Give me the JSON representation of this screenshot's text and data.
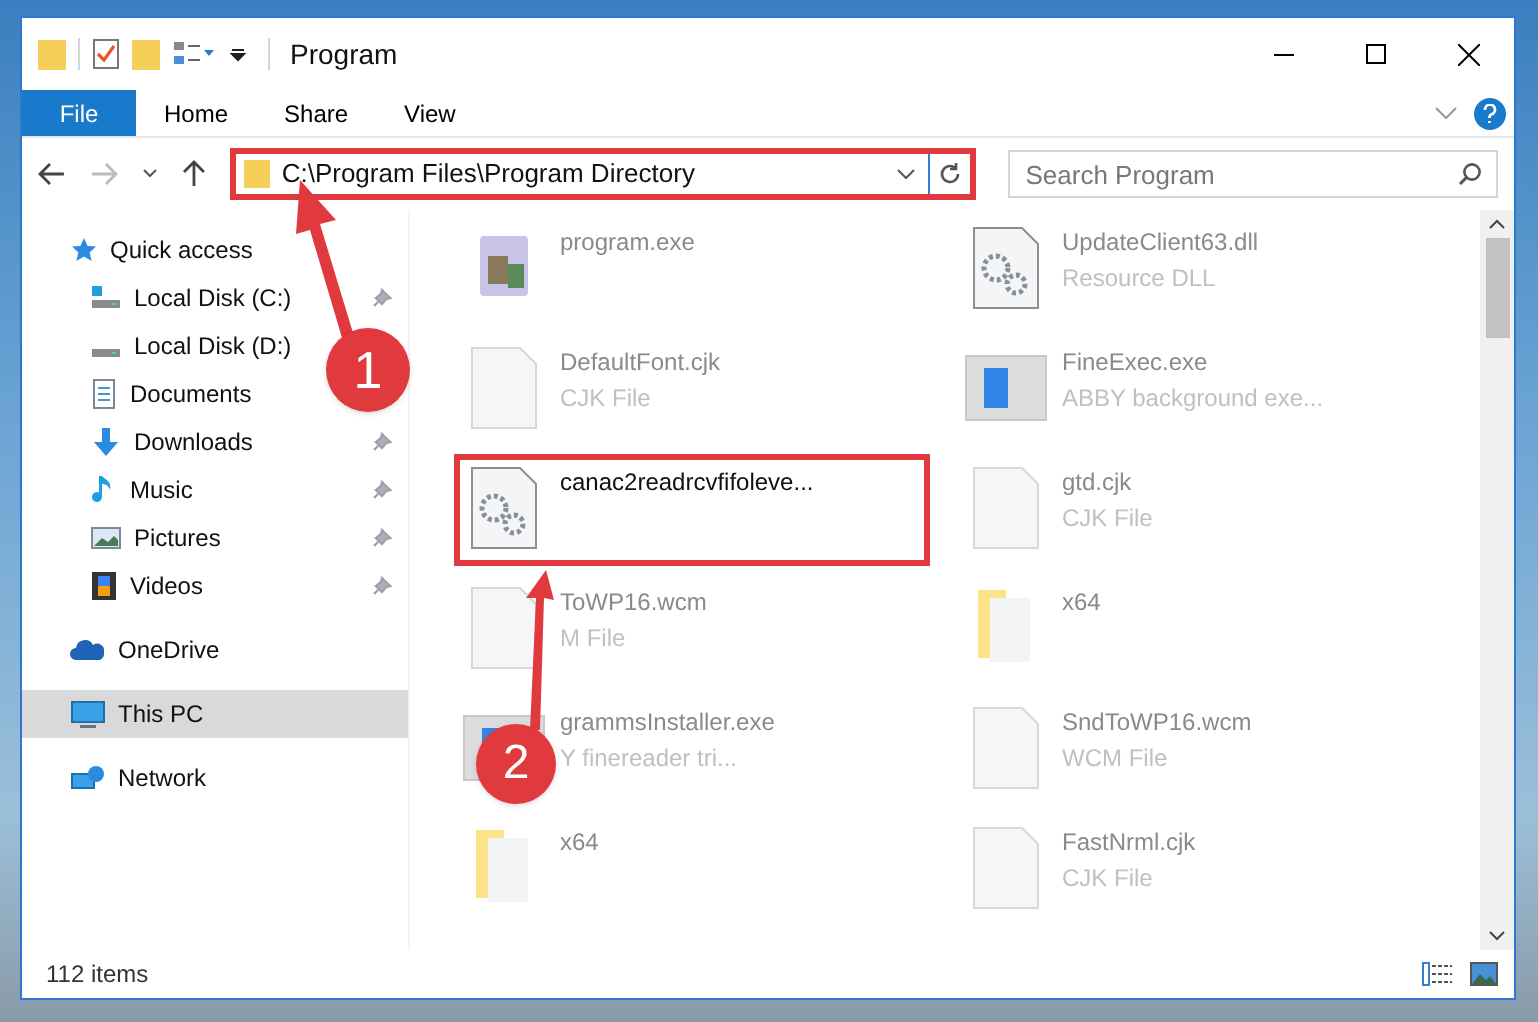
{
  "window": {
    "title": "Program"
  },
  "ribbon_tabs": [
    {
      "label": "File",
      "selected": true
    },
    {
      "label": "Home",
      "selected": false
    },
    {
      "label": "Share",
      "selected": false
    },
    {
      "label": "View",
      "selected": false
    }
  ],
  "address": {
    "path": "C:\\Program Files\\Program Directory",
    "highlighted": true
  },
  "search": {
    "placeholder": "Search Program"
  },
  "sidebar": {
    "items": [
      {
        "label": "Quick access",
        "kind": "star",
        "selected": false,
        "children": [
          {
            "label": "Local Disk (C:)",
            "kind": "drive-c",
            "pinned": true,
            "selected": false
          },
          {
            "label": "Local Disk (D:)",
            "kind": "drive",
            "selected": false
          },
          {
            "label": "Documents",
            "kind": "documents",
            "selected": false
          },
          {
            "label": "Downloads",
            "kind": "downloads",
            "pinned": true,
            "selected": false
          },
          {
            "label": "Music",
            "kind": "music",
            "pinned": true,
            "selected": false
          },
          {
            "label": "Pictures",
            "kind": "pictures",
            "pinned": true,
            "selected": false
          },
          {
            "label": "Videos",
            "kind": "videos",
            "pinned": true,
            "selected": false
          }
        ]
      },
      {
        "label": "OneDrive",
        "kind": "cloud",
        "selected": false
      },
      {
        "label": "This PC",
        "kind": "pc",
        "selected": true
      },
      {
        "label": "Network",
        "kind": "network",
        "selected": false
      }
    ]
  },
  "files": [
    {
      "name": "program.exe",
      "kind": "app",
      "highlighted": false
    },
    {
      "name": "UpdateClient63.dll",
      "type": "Resource DLL",
      "kind": "gears",
      "highlighted": false
    },
    {
      "name": "DefaultFont.cjk",
      "type": "CJK File",
      "kind": "doc",
      "highlighted": false
    },
    {
      "name": "FineExec.exe",
      "type": "ABBY background exe...",
      "kind": "window",
      "highlighted": false
    },
    {
      "name": "canac2readrcvfifoleve...",
      "kind": "gears",
      "highlighted": true
    },
    {
      "name": "gtd.cjk",
      "type": "CJK File",
      "kind": "doc",
      "highlighted": false
    },
    {
      "name": "ToWP16.wcm",
      "type": "M File",
      "kind": "doc",
      "highlighted": false
    },
    {
      "name": "x64",
      "kind": "folder",
      "highlighted": false
    },
    {
      "name": "grammsInstaller.exe",
      "type": "Y finereader tri...",
      "kind": "window",
      "highlighted": false
    },
    {
      "name": "SndToWP16.wcm",
      "type": "WCM File",
      "kind": "doc",
      "highlighted": false
    },
    {
      "name": "x64",
      "kind": "folder",
      "highlighted": false
    },
    {
      "name": "FastNrml.cjk",
      "type": "CJK File",
      "kind": "doc",
      "highlighted": false
    }
  ],
  "status_bar": {
    "count": "112 items"
  },
  "annotations": [
    {
      "label": "1"
    },
    {
      "label": "2"
    }
  ]
}
